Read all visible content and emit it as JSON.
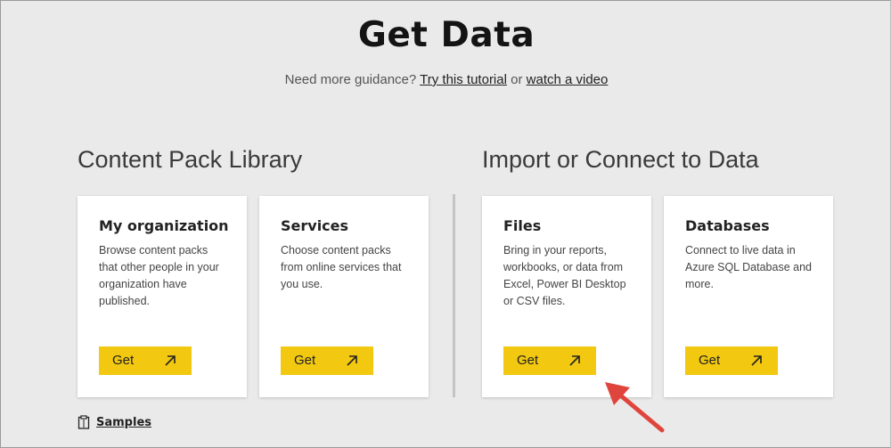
{
  "header": {
    "title": "Get Data",
    "guidance_prefix": "Need more guidance?",
    "tutorial_link": "Try this tutorial",
    "guidance_or": "or",
    "video_link": "watch a video"
  },
  "sections": {
    "content_pack": {
      "heading": "Content Pack Library",
      "cards": [
        {
          "title": "My organization",
          "description": "Browse content packs that other people in your organization have published.",
          "button_label": "Get"
        },
        {
          "title": "Services",
          "description": "Choose content packs from online services that you use.",
          "button_label": "Get"
        }
      ]
    },
    "import_connect": {
      "heading": "Import or Connect to Data",
      "cards": [
        {
          "title": "Files",
          "description": "Bring in your reports, workbooks, or data from Excel, Power BI Desktop or CSV files.",
          "button_label": "Get"
        },
        {
          "title": "Databases",
          "description": "Connect to live data in Azure SQL Database and more.",
          "button_label": "Get"
        }
      ]
    }
  },
  "footer": {
    "samples_label": "Samples"
  },
  "colors": {
    "background": "#eaeaea",
    "accent_button": "#f2c811",
    "annotation_arrow": "#e0453d"
  },
  "icons": {
    "button_icon": "arrow-up-right-icon",
    "samples_icon": "clipboard-icon",
    "annotation": "pointer-arrow"
  }
}
